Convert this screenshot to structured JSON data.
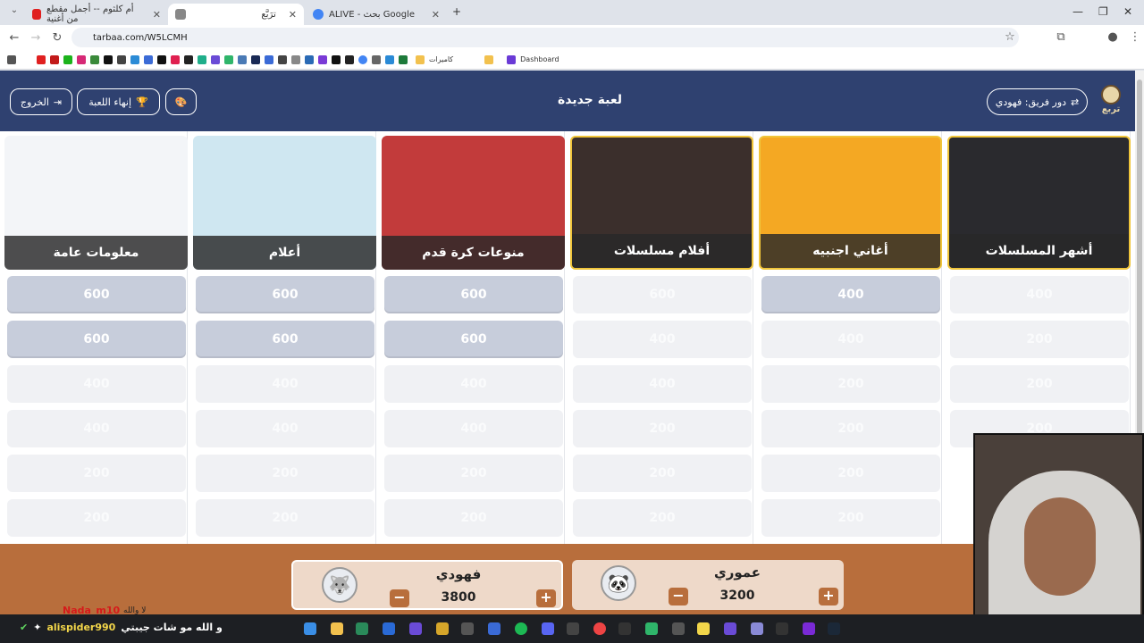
{
  "browser": {
    "tabs": [
      {
        "title": "أم كلثوم -- أجمل مقطع من أغنية",
        "favicon_color": "#e02020",
        "active": false
      },
      {
        "title": "ترَبَّع",
        "favicon_color": "#ffffff",
        "active": true
      },
      {
        "title": "ALIVE - بحث Google",
        "favicon_color": "#4285f4",
        "active": false
      }
    ],
    "new_tab": "+",
    "url": "tarbaa.com/W5LCMH",
    "bookmarks": [
      "كاميرات",
      "Dashboard"
    ]
  },
  "header": {
    "title": "لعبة جديدة",
    "exit_label": "الخروج",
    "end_game_label": "إنهاء اللعبة",
    "turn_label": "دور فريق: فهودي",
    "logo_text": "تربع"
  },
  "categories": [
    {
      "name": "معلومات عامة",
      "color": "#f3f5f8",
      "values": [
        "600",
        "600",
        "400",
        "400",
        "200",
        "200"
      ],
      "active": [
        true,
        true,
        false,
        false,
        false,
        false
      ]
    },
    {
      "name": "أعلام",
      "color": "#cfe7f1",
      "values": [
        "600",
        "600",
        "400",
        "400",
        "200",
        "200"
      ],
      "active": [
        true,
        true,
        false,
        false,
        false,
        false
      ]
    },
    {
      "name": "منوعات كرة قدم",
      "color": "#c23b3b",
      "values": [
        "600",
        "600",
        "400",
        "400",
        "200",
        "200"
      ],
      "active": [
        true,
        true,
        false,
        false,
        false,
        false
      ]
    },
    {
      "name": "أفلام مسلسلات",
      "color": "#3b2f2c",
      "values": [
        "600",
        "400",
        "400",
        "200",
        "200",
        "200"
      ],
      "active": [
        false,
        false,
        false,
        false,
        false,
        false
      ]
    },
    {
      "name": "أغاني اجنبيه",
      "color": "#f4a823",
      "values": [
        "400",
        "400",
        "200",
        "200",
        "200",
        "200"
      ],
      "active": [
        true,
        false,
        false,
        false,
        false,
        false
      ]
    },
    {
      "name": "أشهر المسلسلات",
      "color": "#2a2a2e",
      "values": [
        "400",
        "200",
        "200",
        "200"
      ],
      "active": [
        false,
        false,
        false,
        false
      ]
    }
  ],
  "teams": [
    {
      "name": "فهودي",
      "score": "3800",
      "selected": true,
      "avatar": "🐺"
    },
    {
      "name": "عموري",
      "score": "3200",
      "selected": false,
      "avatar": "🐼"
    }
  ],
  "overlay": {
    "chat_name": "Nada_m10",
    "chat_small": "لا والله",
    "taskbar_user": "alispider990",
    "taskbar_msg": "و الله مو شات جيبتي"
  }
}
